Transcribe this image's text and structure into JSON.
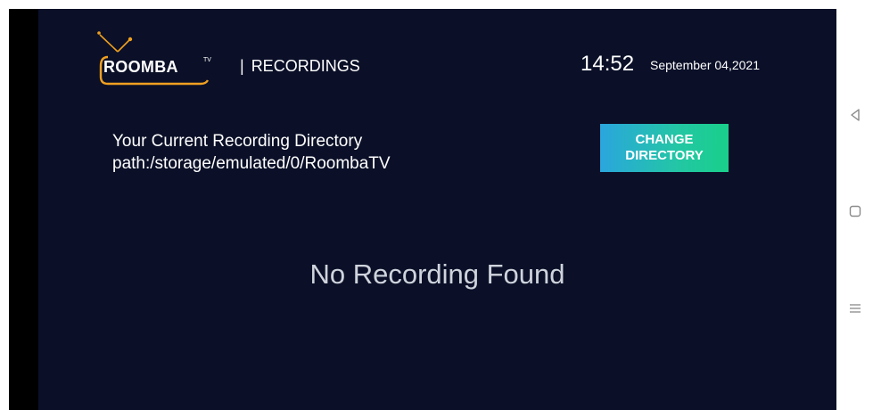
{
  "header": {
    "logo_text": "ROOMBA",
    "logo_sup": "TV",
    "section_separator": "|",
    "section_title": "RECORDINGS",
    "time": "14:52",
    "date": "September 04,2021"
  },
  "recording": {
    "directory_text": "Your Current Recording Directory path:/storage/emulated/0/RoombaTV",
    "change_button_label": "CHANGE\nDIRECTORY",
    "empty_message": "No Recording Found"
  },
  "nav": {
    "icons": [
      "back-icon",
      "home-icon",
      "menu-icon"
    ]
  },
  "colors": {
    "background": "#0b1028",
    "accent_orange": "#f0a020",
    "button_blue": "#2aa6dd",
    "button_green": "#19d08a"
  }
}
